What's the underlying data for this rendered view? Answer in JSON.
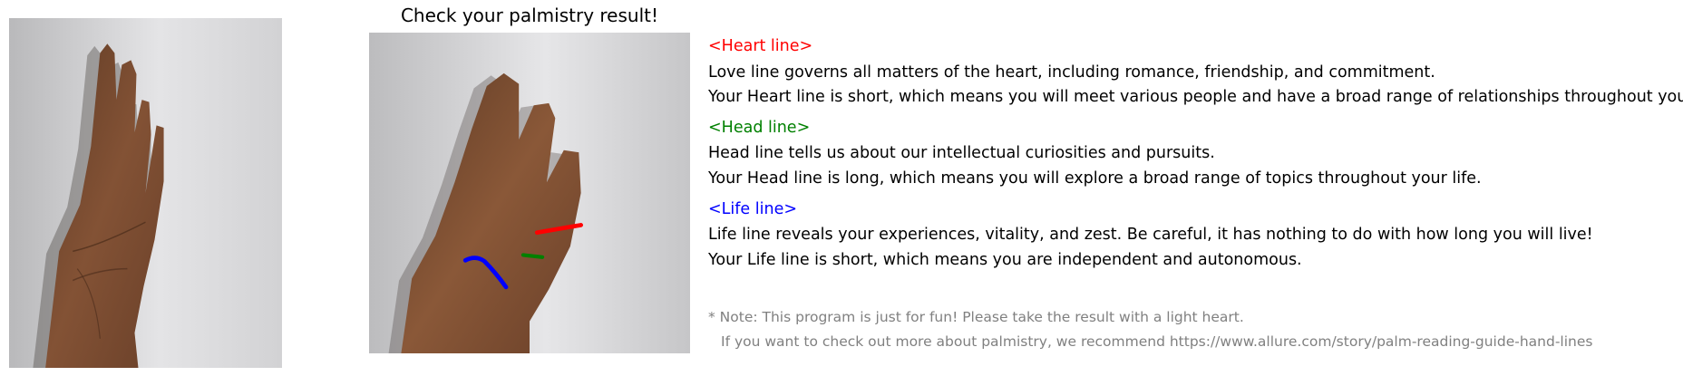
{
  "title": "Check your palmistry result!",
  "colors": {
    "heart": "#ff0000",
    "head": "#008000",
    "life": "#0000ff",
    "note": "#808080"
  },
  "heart": {
    "header": "<Heart line>",
    "description": "Love line governs all matters of the heart, including romance, friendship, and commitment.",
    "result": "Your Heart line is short, which means you will meet various people and have a broad range of relationships throughout your life."
  },
  "head": {
    "header": "<Head line>",
    "description": "Head line tells us about our intellectual curiosities and pursuits.",
    "result": "Your Head line is long, which means you will explore a broad range of topics throughout your life."
  },
  "life": {
    "header": "<Life line>",
    "description": "Life line reveals your experiences, vitality, and zest. Be careful, it has nothing to do with how long you will live!",
    "result": "Your Life line is short, which means you are independent and autonomous."
  },
  "note": {
    "line1": "* Note: This program is just for fun! Please take the result with a light heart.",
    "line2": "If you want to check out more about palmistry, we recommend https://www.allure.com/story/palm-reading-guide-hand-lines"
  }
}
